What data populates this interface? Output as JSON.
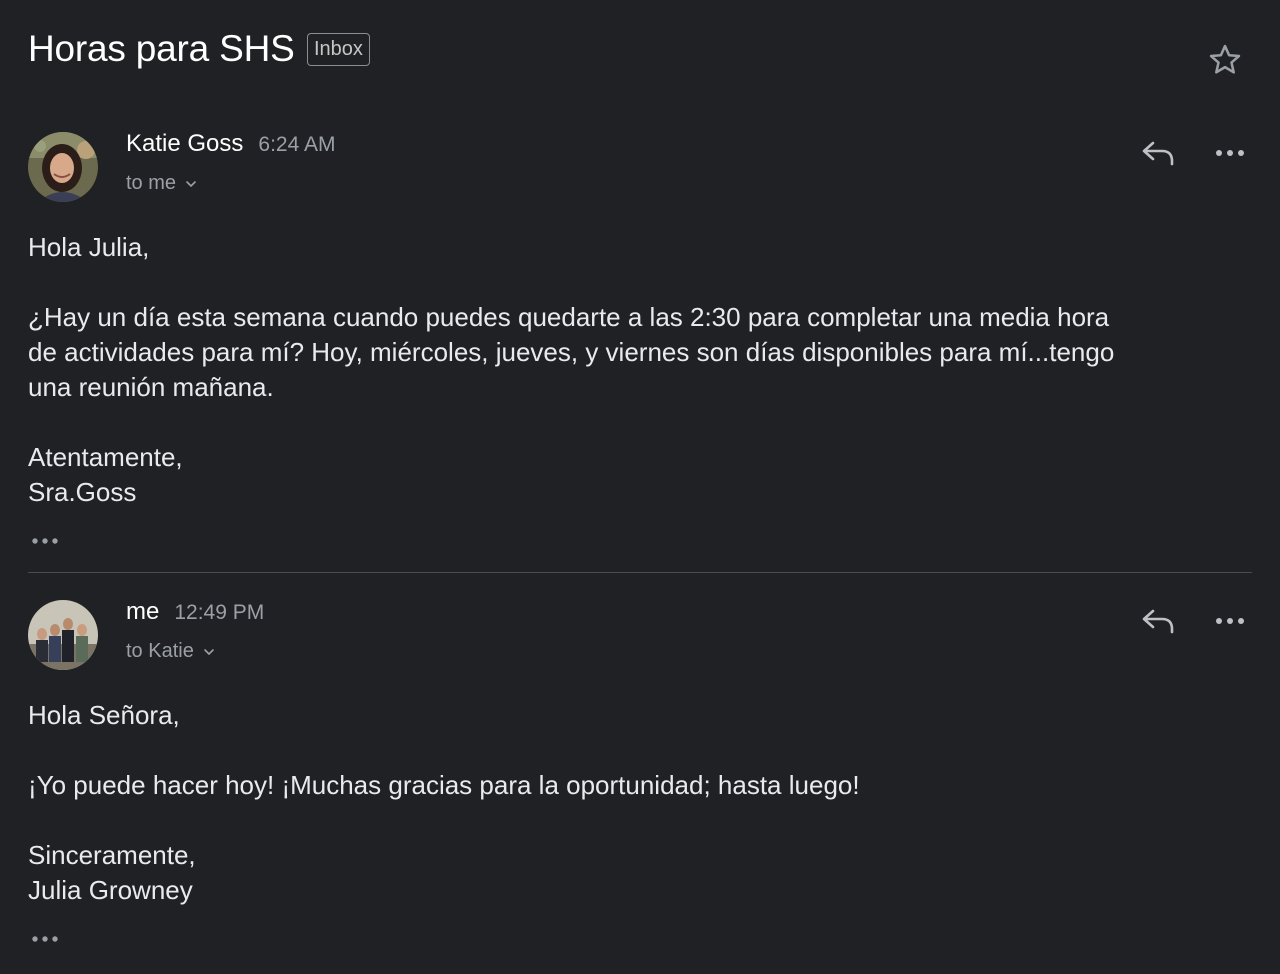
{
  "thread": {
    "subject": "Horas para SHS",
    "label": "Inbox",
    "star_icon": "star-outline-icon"
  },
  "messages": [
    {
      "sender": "Katie Goss",
      "time": "6:24 AM",
      "recipient": "to me",
      "avatar": "portrait-photo",
      "body": {
        "greeting": "Hola Julia,",
        "main_lines": [
          "¿Hay un día esta semana cuando puedes quedarte a las 2:30 para completar una media hora",
          "de actividades para mí? Hoy, miércoles, jueves, y viernes son días disponibles para mí...tengo",
          "una reunión mañana."
        ],
        "closing": "Atentamente,",
        "signature": "Sra.Goss"
      }
    },
    {
      "sender": "me",
      "time": "12:49 PM",
      "recipient": "to Katie",
      "avatar": "group-photo",
      "body": {
        "greeting": "Hola Señora,",
        "main_lines": [
          "¡Yo puede hacer hoy! ¡Muchas gracias para la oportunidad; hasta luego!"
        ],
        "closing": "Sinceramente,",
        "signature": "Julia Growney"
      }
    }
  ],
  "colors": {
    "background": "#202124",
    "text_primary": "#e8eaed",
    "text_secondary": "#9aa0a6",
    "divider": "#4a4c50"
  }
}
